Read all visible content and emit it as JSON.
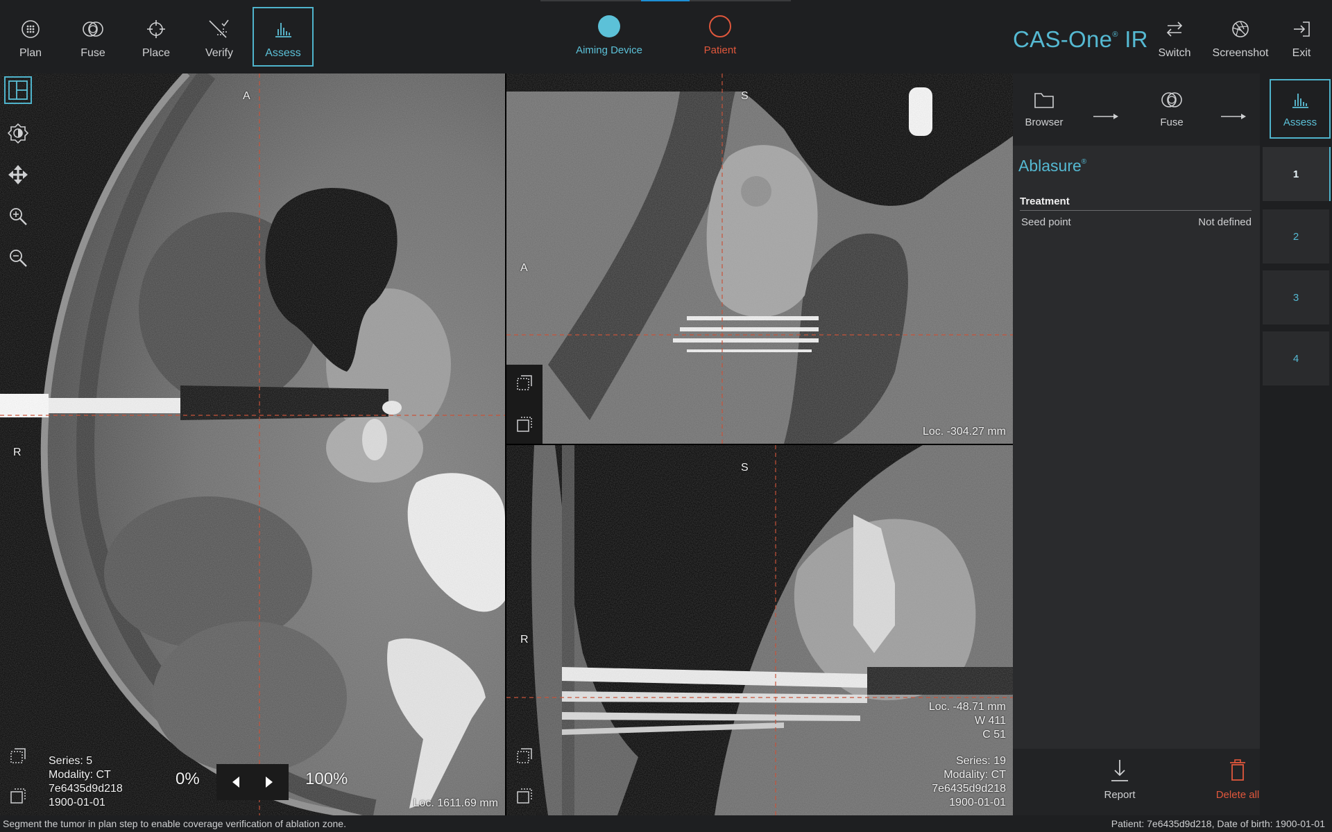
{
  "toolbar": {
    "left_tools": [
      {
        "label": "Plan",
        "icon": "plan-icon"
      },
      {
        "label": "Fuse",
        "icon": "fuse-icon"
      },
      {
        "label": "Place",
        "icon": "crosshair-icon"
      },
      {
        "label": "Verify",
        "icon": "verify-icon"
      },
      {
        "label": "Assess",
        "icon": "assess-chart-icon",
        "active": true
      }
    ],
    "states": [
      {
        "label": "Aiming Device",
        "color": "#4fb4cc",
        "filled": true
      },
      {
        "label": "Patient",
        "color": "#e0573c",
        "filled": false
      }
    ],
    "brand": "CAS-One",
    "brand_mark": "®",
    "brand_suffix": " IR",
    "right_tools": [
      {
        "label": "Switch",
        "icon": "switch-icon"
      },
      {
        "label": "Screenshot",
        "icon": "aperture-icon"
      },
      {
        "label": "Exit",
        "icon": "exit-icon"
      }
    ]
  },
  "view_tools": [
    {
      "name": "layout-icon",
      "active": true
    },
    {
      "name": "brightness-icon"
    },
    {
      "name": "pan-icon"
    },
    {
      "name": "zoom-in-icon"
    },
    {
      "name": "zoom-out-icon"
    }
  ],
  "axial": {
    "orient_top": "A",
    "orient_left": "R",
    "series": "Series: 5",
    "modality": "Modality: CT",
    "patient_id": "7e6435d9d218",
    "date": "1900-01-01",
    "fusion_min": "0%",
    "fusion_max": "100%",
    "loc": "Loc. 1611.69 mm"
  },
  "sagittal": {
    "orient_top": "S",
    "orient_left": "A",
    "loc": "Loc. -304.27 mm"
  },
  "coronal": {
    "orient_top": "S",
    "orient_left": "R",
    "loc": "Loc. -48.71 mm",
    "window": "W 411",
    "center": "C 51",
    "series": "Series: 19",
    "modality": "Modality: CT",
    "patient_id": "7e6435d9d218",
    "date": "1900-01-01"
  },
  "workflow": {
    "steps": [
      {
        "label": "Browser",
        "icon": "folder-icon"
      },
      {
        "label": "Fuse",
        "icon": "fuse-icon"
      },
      {
        "label": "Assess",
        "icon": "assess-chart-icon",
        "active": true
      }
    ]
  },
  "ablasure": {
    "title": "Ablasure",
    "mark": "®",
    "section": "Treatment",
    "rows": [
      {
        "label": "Seed point",
        "value": "Not defined"
      }
    ]
  },
  "slots": [
    "1",
    "2",
    "3",
    "4"
  ],
  "footer": {
    "report": "Report",
    "delete_all": "Delete all",
    "delete_color": "#e0573c"
  },
  "status": {
    "message": "Segment the tumor in plan step to enable coverage verification of ablation zone.",
    "patient": "Patient: 7e6435d9d218,  Date of birth: 1900-01-01"
  }
}
